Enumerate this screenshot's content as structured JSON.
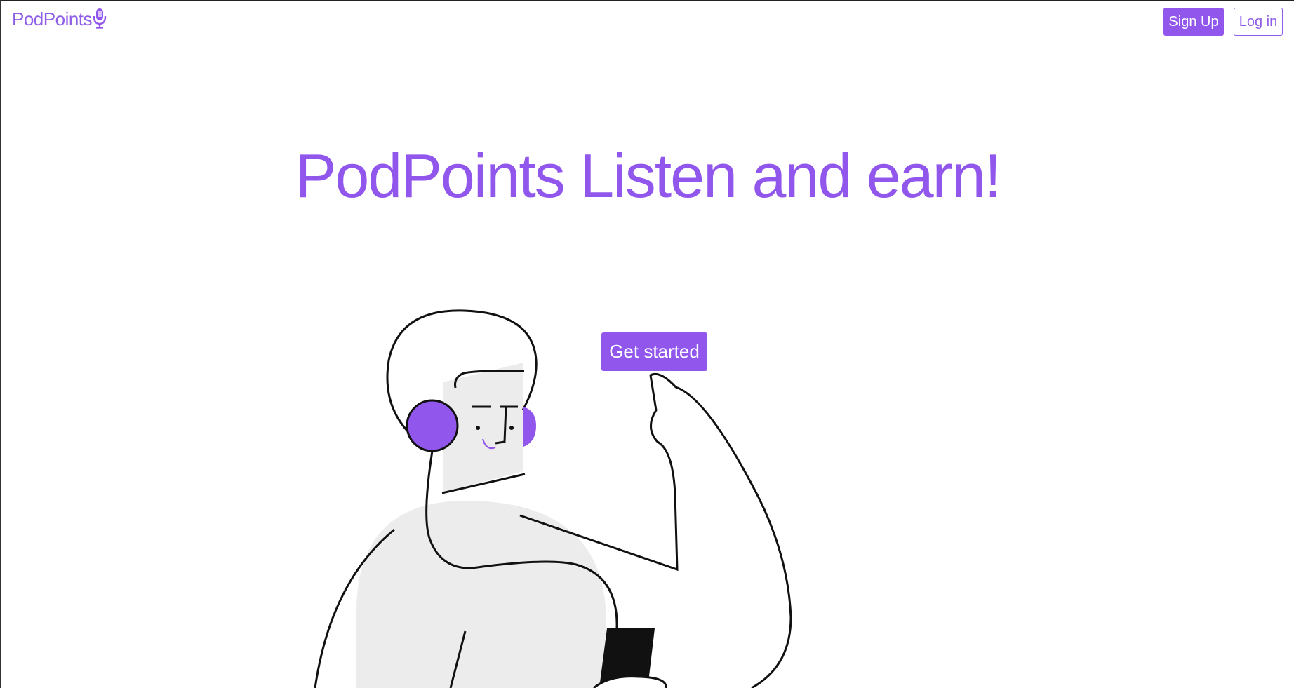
{
  "header": {
    "logo_text": "PodPoints",
    "logo_icon": "microphone-icon",
    "signup_label": "Sign Up",
    "login_label": "Log in"
  },
  "hero": {
    "title": "PodPoints Listen and earn!",
    "cta_label": "Get started",
    "illustration": "person-with-headphones-holding-phone"
  },
  "colors": {
    "brand": "#9157ec",
    "illustration_fill": "#ececed",
    "line": "#111111"
  }
}
